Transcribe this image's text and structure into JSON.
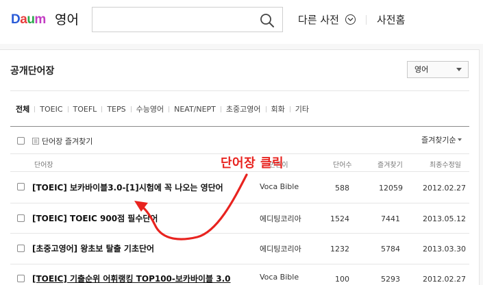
{
  "header": {
    "logo_letters": [
      "D",
      "a",
      "u",
      "m"
    ],
    "service_name": "영어",
    "search": {
      "value": "",
      "placeholder": ""
    },
    "other_dict_label": "다른 사전",
    "dict_home_label": "사전홈"
  },
  "page": {
    "title": "공개단어장",
    "language_select": "영어"
  },
  "tabs": [
    "전체",
    "TOEIC",
    "TOEFL",
    "TEPS",
    "수능영어",
    "NEAT/NEPT",
    "초중고영어",
    "회화",
    "기타"
  ],
  "toolbar": {
    "favorite_label": "단어장 즐겨찾기",
    "sort_label": "즐겨찾기순"
  },
  "columns": {
    "name": "단어장",
    "author": "만든이",
    "word_count": "단어수",
    "favorites": "즐겨찾기",
    "modified": "최종수정일"
  },
  "rows": [
    {
      "title": "[TOEIC] 보카바이블3.0-[1]시험에 꼭 나오는 영단어",
      "author": "Voca Bible",
      "count": "588",
      "favorites": "12059",
      "date": "2012.02.27"
    },
    {
      "title": "[TOEIC] TOEIC 900점 필수단어",
      "author": "에디팅코리아",
      "count": "1524",
      "favorites": "7441",
      "date": "2013.05.12"
    },
    {
      "title": "[초중고영어] 왕초보 탈출 기초단어",
      "author": "에디팅코리아",
      "count": "1232",
      "favorites": "5784",
      "date": "2013.03.30"
    },
    {
      "title": "[TOEIC] 기출순위 어휘랭킹 TOP100-보카바이블 3.0",
      "author": "Voca Bible",
      "count": "100",
      "favorites": "5293",
      "date": "2012.02.27"
    }
  ],
  "annotation": {
    "text": "단어장 클릭",
    "color": "#e8231f"
  }
}
